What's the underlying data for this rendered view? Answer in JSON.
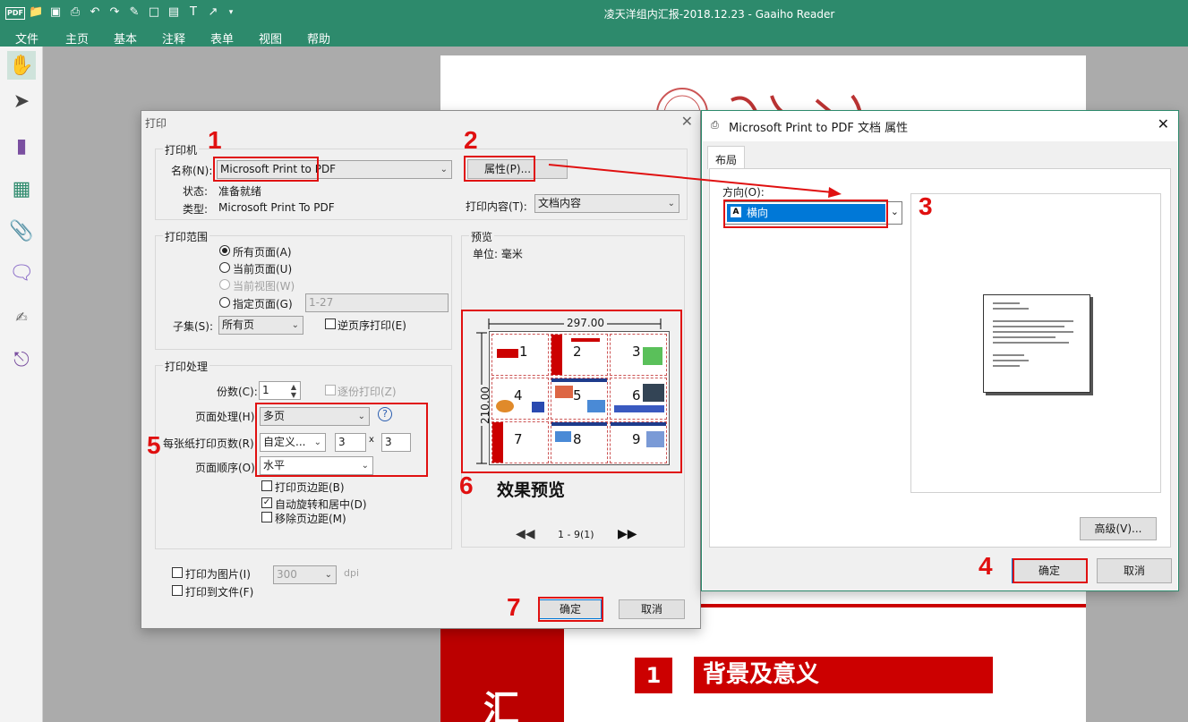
{
  "app": {
    "title": "凌天洋组内汇报-2018.12.23 - Gaaiho Reader",
    "logo": "PDF",
    "menu": [
      "文件",
      "主页",
      "基本",
      "注释",
      "表单",
      "视图",
      "帮助"
    ],
    "quick_access_icons": [
      "open-folder-icon",
      "save-icon",
      "print-icon",
      "undo-icon",
      "redo-icon",
      "eraser-icon",
      "rectangle-icon",
      "textbox-icon",
      "text-field-icon",
      "arrow-icon",
      "more-icon"
    ],
    "sidebar_icons": [
      "hand-tool-icon",
      "select-tool-icon",
      "bookmark-icon",
      "thumbnails-icon",
      "attachment-icon",
      "comment-icon",
      "signature-icon",
      "stamp-icon"
    ]
  },
  "document": {
    "slide_mark": "汇",
    "section_number": "1",
    "section_title": "背景及意义"
  },
  "print_dialog": {
    "title": "打印",
    "printer": {
      "group_title": "打印机",
      "name_label": "名称(N):",
      "name_value": "Microsoft Print to PDF",
      "properties_button": "属性(P)...",
      "status_label": "状态:",
      "status_value": "准备就绪",
      "type_label": "类型:",
      "type_value": "Microsoft Print To PDF",
      "content_label": "打印内容(T):",
      "content_value": "文档内容"
    },
    "range": {
      "group_title": "打印范围",
      "all_pages": "所有页面(A)",
      "current_page": "当前页面(U)",
      "current_view": "当前视图(W)",
      "specified_pages": "指定页面(G)",
      "pages_placeholder": "1-27",
      "subset_label": "子集(S):",
      "subset_value": "所有页",
      "reverse_label": "逆页序打印(E)"
    },
    "handling": {
      "group_title": "打印处理",
      "copies_label": "份数(C):",
      "copies_value": "1",
      "collate_label": "逐份打印(Z)",
      "page_handling_label": "页面处理(H)",
      "page_handling_value": "多页",
      "help_icon": "?",
      "pages_per_sheet_label": "每张纸打印页数(R)",
      "pages_per_sheet_value": "自定义...",
      "cols": "3",
      "times": "x",
      "rows": "3",
      "page_order_label": "页面顺序(O)",
      "page_order_value": "水平",
      "print_borders": "打印页边距(B)",
      "auto_rotate": "自动旋转和居中(D)",
      "remove_margins": "移除页边距(M)"
    },
    "preview": {
      "group_title": "预览",
      "unit": "单位: 毫米",
      "width": "297.00",
      "height": "210.00",
      "thumbnail_numbers": [
        "1",
        "2",
        "3",
        "4",
        "5",
        "6",
        "7",
        "8",
        "9"
      ],
      "page_indicator": "1 - 9(1)"
    },
    "print_as_image": "打印为图片(I)",
    "dpi_value": "300",
    "dpi_unit": "dpi",
    "print_to_file": "打印到文件(F)",
    "ok_button": "确定",
    "cancel_button": "取消"
  },
  "properties_dialog": {
    "title": "Microsoft Print to PDF 文档 属性",
    "tab": "布局",
    "orientation_label": "方向(O):",
    "orientation_value": "横向",
    "advanced_button": "高级(V)...",
    "ok_button": "确定",
    "cancel_button": "取消"
  },
  "annotations": {
    "labels": [
      "1",
      "2",
      "3",
      "4",
      "5",
      "6",
      "7"
    ],
    "caption_6": "效果预览",
    "color": "#e01010"
  }
}
